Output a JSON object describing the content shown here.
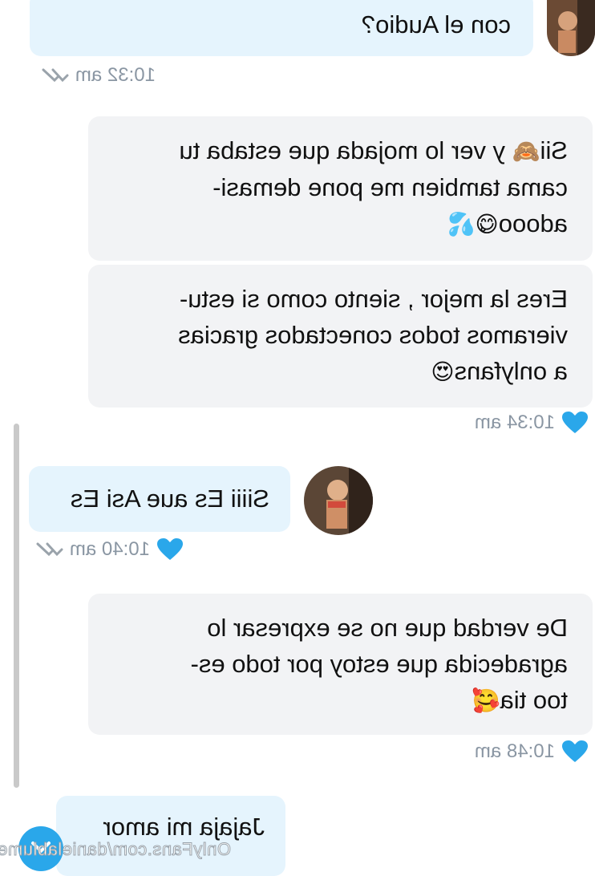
{
  "messages": [
    {
      "side": "in",
      "text": "con el Audio?"
    },
    {
      "side": "out",
      "text": "Sii",
      "emoji_after_1": "🙈",
      "text_b": " y ver lo mojada que estaba tu\ncama tambien me pone demasi-\nadooo",
      "emoji_after_2": "😋💦"
    },
    {
      "side": "out",
      "text": "Eres la mejor , siento como si estu-\nvieramos todos conectados gracias\na onlyfans",
      "emoji_after": "😍"
    },
    {
      "side": "in",
      "text": "Siiii Es aue Asi Es"
    },
    {
      "side": "out",
      "text": "De verdad que no se expresar lo\nagradecida que estoy por todo es-\ntoo tia",
      "emoji_after": "🥰"
    },
    {
      "side": "in",
      "text": "Jajaja mi amor"
    }
  ],
  "timestamps": [
    "10:32 am",
    "10:34 am",
    "10:40 am",
    "10:48 am"
  ],
  "watermark": "OnlyFans.com/danielablume",
  "colors": {
    "incoming_bubble": "#e5f4fd",
    "outgoing_bubble": "#f2f3f5",
    "heart": "#2aa7ea",
    "timestamp": "#8a96a3"
  },
  "icons": {
    "liked": "heart-icon",
    "read_receipt": "double-check-icon",
    "scroll_button": "chevron-down-icon"
  }
}
